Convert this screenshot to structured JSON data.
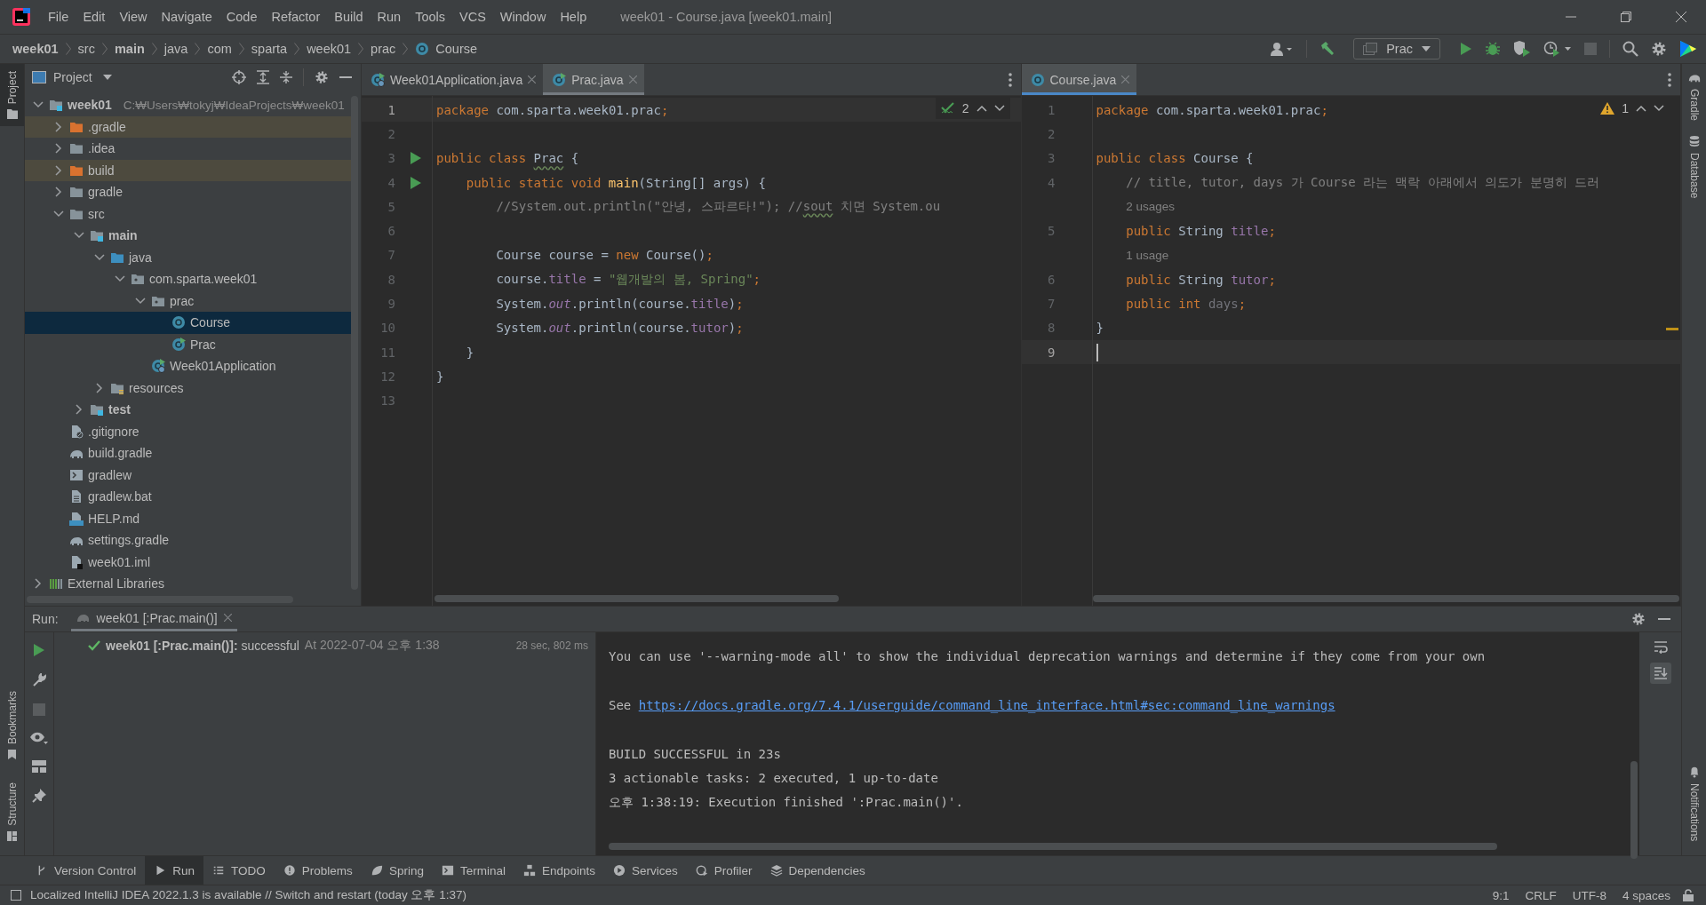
{
  "window": {
    "title": "week01 - Course.java [week01.main]"
  },
  "menu": [
    "File",
    "Edit",
    "View",
    "Navigate",
    "Code",
    "Refactor",
    "Build",
    "Run",
    "Tools",
    "VCS",
    "Window",
    "Help"
  ],
  "breadcrumbs": [
    {
      "label": "week01",
      "kind": "module"
    },
    {
      "label": "src",
      "kind": "folder"
    },
    {
      "label": "main",
      "kind": "module"
    },
    {
      "label": "java",
      "kind": "folder"
    },
    {
      "label": "com",
      "kind": "folder"
    },
    {
      "label": "sparta",
      "kind": "folder"
    },
    {
      "label": "week01",
      "kind": "folder"
    },
    {
      "label": "prac",
      "kind": "folder"
    },
    {
      "label": "Course",
      "kind": "class"
    }
  ],
  "toolbar": {
    "run_configuration": "Prac"
  },
  "left_stripe_top": [
    {
      "label": "Project",
      "selected": true
    }
  ],
  "left_stripe_bottom": [
    {
      "label": "Bookmarks",
      "selected": false
    },
    {
      "label": "Structure",
      "selected": false
    }
  ],
  "right_stripe_top": [
    {
      "label": "Gradle",
      "kind": "gradle"
    },
    {
      "label": "Database",
      "kind": "database"
    }
  ],
  "right_stripe_bottom": [
    {
      "label": "Notifications",
      "kind": "bell"
    }
  ],
  "project": {
    "title": "Project",
    "tree": [
      {
        "name": "week01",
        "kind": "module",
        "path": "C:₩Users₩tokyj₩IdeaProjects₩week01",
        "expanded": true,
        "selected": false,
        "excluded": false,
        "children": [
          {
            "name": ".gradle",
            "kind": "excluded-folder",
            "expanded": false,
            "selected": false,
            "excluded": true
          },
          {
            "name": ".idea",
            "kind": "folder",
            "expanded": false,
            "selected": false,
            "excluded": false
          },
          {
            "name": "build",
            "kind": "excluded-folder",
            "expanded": false,
            "selected": false,
            "excluded": true
          },
          {
            "name": "gradle",
            "kind": "folder",
            "expanded": false,
            "selected": false,
            "excluded": false
          },
          {
            "name": "src",
            "kind": "folder",
            "expanded": true,
            "selected": false,
            "excluded": false,
            "children": [
              {
                "name": "main",
                "kind": "module",
                "expanded": true,
                "selected": false,
                "excluded": false,
                "children": [
                  {
                    "name": "java",
                    "kind": "java-root",
                    "expanded": true,
                    "selected": false,
                    "excluded": false,
                    "children": [
                      {
                        "name": "com.sparta.week01",
                        "kind": "package",
                        "expanded": true,
                        "selected": false,
                        "excluded": false,
                        "children": [
                          {
                            "name": "prac",
                            "kind": "package",
                            "expanded": true,
                            "selected": false,
                            "excluded": false,
                            "children": [
                              {
                                "name": "Course",
                                "kind": "class",
                                "selected": true,
                                "excluded": false
                              },
                              {
                                "name": "Prac",
                                "kind": "runnable-class",
                                "selected": false,
                                "excluded": false
                              }
                            ]
                          },
                          {
                            "name": "Week01Application",
                            "kind": "spring-class",
                            "selected": false,
                            "excluded": false
                          }
                        ]
                      }
                    ]
                  },
                  {
                    "name": "resources",
                    "kind": "resources",
                    "expanded": false,
                    "selected": false,
                    "excluded": false
                  }
                ]
              },
              {
                "name": "test",
                "kind": "module",
                "expanded": false,
                "selected": false,
                "excluded": false
              }
            ]
          },
          {
            "name": ".gitignore",
            "kind": "ignore-file",
            "selected": false,
            "excluded": false
          },
          {
            "name": "build.gradle",
            "kind": "gradle-file",
            "selected": false,
            "excluded": false
          },
          {
            "name": "gradlew",
            "kind": "shell-file",
            "selected": false,
            "excluded": false
          },
          {
            "name": "gradlew.bat",
            "kind": "text-file",
            "selected": false,
            "excluded": false
          },
          {
            "name": "HELP.md",
            "kind": "md-file",
            "selected": false,
            "excluded": false
          },
          {
            "name": "settings.gradle",
            "kind": "gradle-file",
            "selected": false,
            "excluded": false
          },
          {
            "name": "week01.iml",
            "kind": "iml-file",
            "selected": false,
            "excluded": false
          }
        ]
      },
      {
        "name": "External Libraries",
        "kind": "libraries",
        "expanded": false,
        "selected": false,
        "excluded": false
      }
    ]
  },
  "editors": [
    {
      "active": false,
      "tabs": [
        {
          "label": "Week01Application.java",
          "kind": "spring-class",
          "selected": false
        },
        {
          "label": "Prac.java",
          "kind": "runnable-class",
          "selected": true
        }
      ],
      "inspection": {
        "kind": "ok",
        "count": "2"
      },
      "lines": [
        {
          "kind": "code",
          "num": "1",
          "current": true,
          "run": false,
          "tokens": [
            {
              "text": "package",
              "kind": "kw"
            },
            {
              "text": " com.sparta.week01.prac",
              "kind": "id"
            },
            {
              "text": ";",
              "kind": "kw"
            }
          ]
        },
        {
          "kind": "code",
          "num": "2",
          "current": false,
          "run": false
        },
        {
          "kind": "code",
          "num": "3",
          "current": false,
          "run": true,
          "tokens": [
            {
              "text": "public class ",
              "kind": "kw"
            },
            {
              "text": "Prac",
              "kind": "typo"
            },
            {
              "text": " {",
              "kind": "id"
            }
          ]
        },
        {
          "kind": "code",
          "num": "4",
          "current": false,
          "run": true,
          "tokens": [
            {
              "text": "    public static void ",
              "kind": "kw"
            },
            {
              "text": "main",
              "kind": "method"
            },
            {
              "text": "(String[] args) {",
              "kind": "id"
            }
          ]
        },
        {
          "kind": "code",
          "num": "5",
          "current": false,
          "run": false,
          "tokens": [
            {
              "text": "        //System.out.println(\"안녕, 스파르타!\"); //",
              "kind": "comment"
            },
            {
              "text": "sout",
              "kind": "comment-typo"
            },
            {
              "text": " 치면 System.ou",
              "kind": "comment"
            }
          ]
        },
        {
          "kind": "code",
          "num": "6",
          "current": false,
          "run": false
        },
        {
          "kind": "code",
          "num": "7",
          "current": false,
          "run": false,
          "tokens": [
            {
              "text": "        Course course = ",
              "kind": "id"
            },
            {
              "text": "new",
              "kind": "kw"
            },
            {
              "text": " Course()",
              "kind": "id"
            },
            {
              "text": ";",
              "kind": "kw"
            }
          ]
        },
        {
          "kind": "code",
          "num": "8",
          "current": false,
          "run": false,
          "tokens": [
            {
              "text": "        course.",
              "kind": "id"
            },
            {
              "text": "title",
              "kind": "field"
            },
            {
              "text": " = ",
              "kind": "id"
            },
            {
              "text": "\"웹개발의 봄, Spring\"",
              "kind": "str"
            },
            {
              "text": ";",
              "kind": "kw"
            }
          ]
        },
        {
          "kind": "code",
          "num": "9",
          "current": false,
          "run": false,
          "tokens": [
            {
              "text": "        System.",
              "kind": "id"
            },
            {
              "text": "out",
              "kind": "static"
            },
            {
              "text": ".println(course.",
              "kind": "id"
            },
            {
              "text": "title",
              "kind": "field"
            },
            {
              "text": ")",
              "kind": "id"
            },
            {
              "text": ";",
              "kind": "kw"
            }
          ]
        },
        {
          "kind": "code",
          "num": "10",
          "current": false,
          "run": false,
          "tokens": [
            {
              "text": "        System.",
              "kind": "id"
            },
            {
              "text": "out",
              "kind": "static"
            },
            {
              "text": ".println(course.",
              "kind": "id"
            },
            {
              "text": "tutor",
              "kind": "field"
            },
            {
              "text": ")",
              "kind": "id"
            },
            {
              "text": ";",
              "kind": "kw"
            }
          ]
        },
        {
          "kind": "code",
          "num": "11",
          "current": false,
          "run": false,
          "tokens": [
            {
              "text": "    }",
              "kind": "id"
            }
          ]
        },
        {
          "kind": "code",
          "num": "12",
          "current": false,
          "run": false,
          "tokens": [
            {
              "text": "}",
              "kind": "id"
            }
          ]
        },
        {
          "kind": "code",
          "num": "13",
          "current": false,
          "run": false
        }
      ]
    },
    {
      "active": true,
      "tabs": [
        {
          "label": "Course.java",
          "kind": "class",
          "selected": true
        }
      ],
      "inspection": {
        "kind": "warning",
        "count": "1"
      },
      "lines": [
        {
          "kind": "code",
          "num": "1",
          "current": false,
          "run": false,
          "tokens": [
            {
              "text": "package",
              "kind": "kw"
            },
            {
              "text": " com.sparta.week01.prac",
              "kind": "id"
            },
            {
              "text": ";",
              "kind": "kw"
            }
          ]
        },
        {
          "kind": "code",
          "num": "2",
          "current": false,
          "run": false
        },
        {
          "kind": "code",
          "num": "3",
          "current": false,
          "run": false,
          "tokens": [
            {
              "text": "public class ",
              "kind": "kw"
            },
            {
              "text": "Course {",
              "kind": "id"
            }
          ]
        },
        {
          "kind": "code",
          "num": "4",
          "current": false,
          "run": false,
          "tokens": [
            {
              "text": "    // title, tutor, days 가 Course 라는 맥락 아래에서 의도가 분명히 드러",
              "kind": "comment"
            }
          ]
        },
        {
          "kind": "hint",
          "text": "    2 usages"
        },
        {
          "kind": "code",
          "num": "5",
          "current": false,
          "run": false,
          "tokens": [
            {
              "text": "    public ",
              "kind": "kw"
            },
            {
              "text": "String ",
              "kind": "id"
            },
            {
              "text": "title",
              "kind": "field"
            },
            {
              "text": ";",
              "kind": "kw"
            }
          ]
        },
        {
          "kind": "hint",
          "text": "    1 usage"
        },
        {
          "kind": "code",
          "num": "6",
          "current": false,
          "run": false,
          "tokens": [
            {
              "text": "    public ",
              "kind": "kw"
            },
            {
              "text": "String ",
              "kind": "id"
            },
            {
              "text": "tutor",
              "kind": "field"
            },
            {
              "text": ";",
              "kind": "kw"
            }
          ]
        },
        {
          "kind": "code",
          "num": "7",
          "current": false,
          "run": false,
          "tokens": [
            {
              "text": "    public int ",
              "kind": "kw"
            },
            {
              "text": "days",
              "kind": "unused"
            },
            {
              "text": ";",
              "kind": "kw"
            }
          ]
        },
        {
          "kind": "code",
          "num": "8",
          "current": false,
          "run": false,
          "tokens": [
            {
              "text": "}",
              "kind": "id"
            }
          ]
        },
        {
          "kind": "code",
          "num": "9",
          "current": true,
          "run": false
        }
      ]
    }
  ],
  "run": {
    "label": "Run:",
    "tab": {
      "label": "week01 [:Prac.main()]",
      "selected": true
    },
    "tree": [
      {
        "succeeded": true,
        "title": "**week01 [:Prac.main()]:** successful",
        "time": "At 2022-07-04 오후 1:38",
        "duration": "28 sec, 802 ms"
      }
    ],
    "console": [
      {
        "kind": "text",
        "text": "You can use '--warning-mode all' to show the individual deprecation warnings and determine if they come from your own"
      },
      {
        "kind": "blank"
      },
      {
        "kind": "link",
        "prefix": "See ",
        "url": "https://docs.gradle.org/7.4.1/userguide/command_line_interface.html#sec:command_line_warnings"
      },
      {
        "kind": "blank"
      },
      {
        "kind": "text",
        "text": "BUILD SUCCESSFUL in 23s"
      },
      {
        "kind": "text",
        "text": "3 actionable tasks: 2 executed, 1 up-to-date"
      },
      {
        "kind": "text",
        "text": "오후 1:38:19: Execution finished ':Prac.main()'."
      }
    ]
  },
  "tool_windows": [
    {
      "label": "Version Control",
      "selected": false
    },
    {
      "label": "Run",
      "selected": true
    },
    {
      "label": "TODO",
      "selected": false
    },
    {
      "label": "Problems",
      "selected": false
    },
    {
      "label": "Spring",
      "selected": false
    },
    {
      "label": "Terminal",
      "selected": false
    },
    {
      "label": "Endpoints",
      "selected": false
    },
    {
      "label": "Services",
      "selected": false
    },
    {
      "label": "Profiler",
      "selected": false
    },
    {
      "label": "Dependencies",
      "selected": false
    }
  ],
  "status_bar": {
    "message": "Localized IntelliJ IDEA 2022.1.3 is available // Switch and restart (today 오후 1:37)",
    "items": [
      "9:1",
      "CRLF",
      "UTF-8",
      "4 spaces"
    ]
  }
}
